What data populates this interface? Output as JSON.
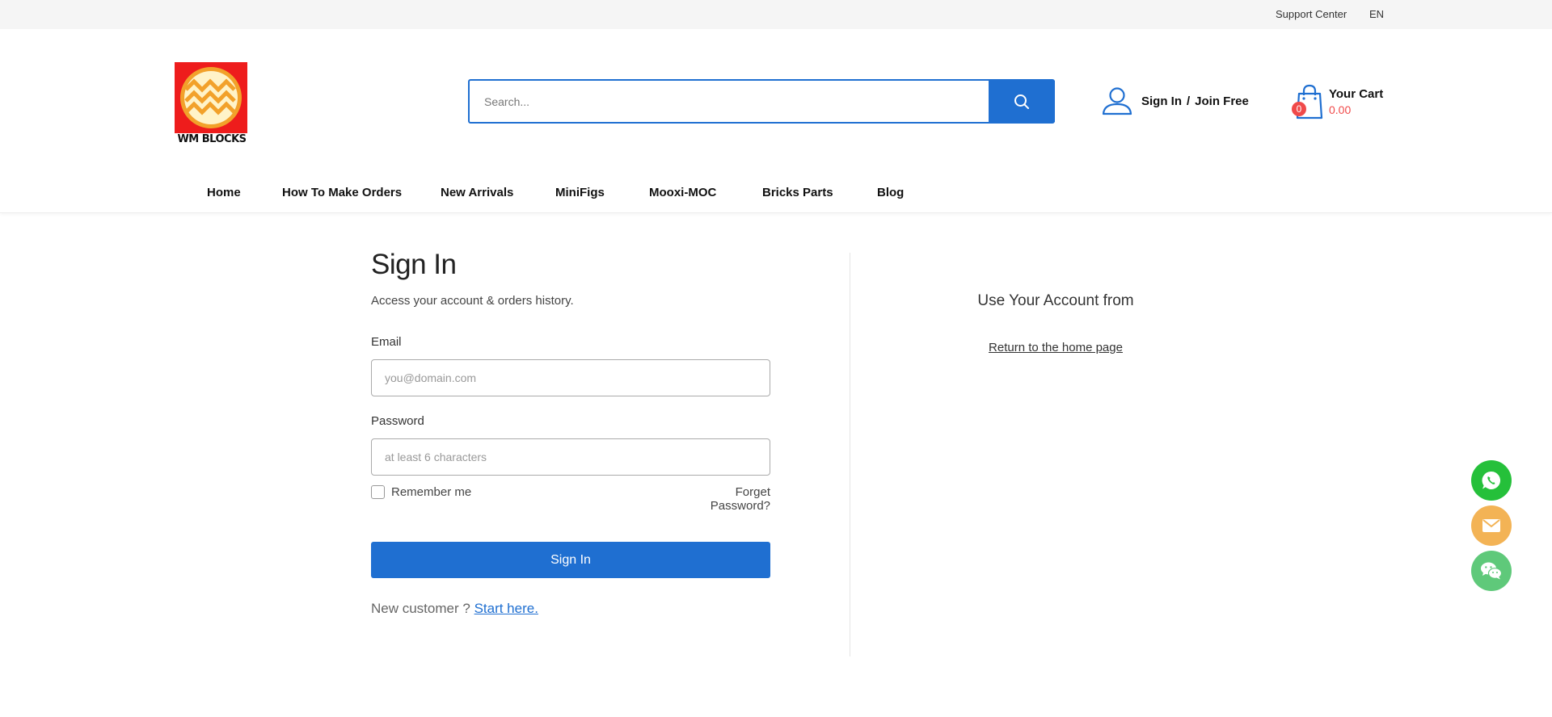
{
  "topbar": {
    "support": "Support Center",
    "lang": "EN"
  },
  "header": {
    "brand": "WM BLOCKS",
    "search": {
      "placeholder": "Search..."
    },
    "account": {
      "sign_in": "Sign In",
      "sep": "/",
      "join": "Join Free"
    },
    "cart": {
      "count": "0",
      "title": "Your Cart",
      "amount": "0.00"
    }
  },
  "nav": {
    "items": [
      {
        "label": "Home"
      },
      {
        "label": "How To Make Orders"
      },
      {
        "label": "New Arrivals"
      },
      {
        "label": "MiniFigs"
      },
      {
        "label": "Mooxi-MOC"
      },
      {
        "label": "Bricks Parts"
      },
      {
        "label": "Blog"
      }
    ]
  },
  "signin": {
    "title": "Sign In",
    "subtitle": "Access your account & orders history.",
    "email_label": "Email",
    "email_placeholder": "you@domain.com",
    "password_label": "Password",
    "password_placeholder": "at least 6 characters",
    "remember": "Remember me",
    "forget": "Forget Password?",
    "submit": "Sign In",
    "new_customer": "New customer ?",
    "start_here": "Start here."
  },
  "side": {
    "title": "Use Your Account from",
    "home_link": "Return to the home page"
  },
  "colors": {
    "accent": "#1f6fd1",
    "cart_red": "#f04a4a",
    "logo_red": "#ee1c1c",
    "whatsapp": "#25c03a",
    "email": "#f3b355",
    "wechat": "#5fc97a"
  },
  "floating": [
    {
      "icon": "whatsapp-icon"
    },
    {
      "icon": "mail-icon"
    },
    {
      "icon": "wechat-icon"
    }
  ]
}
